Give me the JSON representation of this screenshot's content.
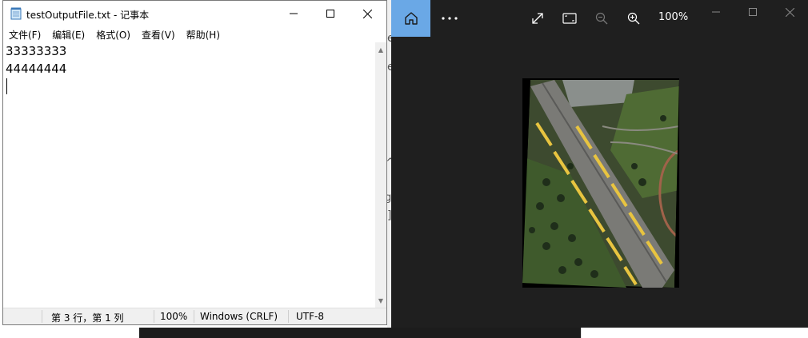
{
  "notepad": {
    "title": "testOutputFile.txt - 记事本",
    "menu": [
      "文件(F)",
      "编辑(E)",
      "格式(O)",
      "查看(V)",
      "帮助(H)"
    ],
    "lines": [
      "33333333",
      "44444444"
    ],
    "status": {
      "position": "第 3 行，第 1 列",
      "zoom": "100%",
      "line_ending": "Windows (CRLF)",
      "encoding": "UTF-8"
    }
  },
  "viewer": {
    "zoom": "100%",
    "icons": [
      "home-icon",
      "more-icon",
      "expand-icon",
      "fit-icon",
      "zoom-out-icon",
      "zoom-in-icon"
    ],
    "accent_color": "#6aa8e6"
  },
  "background": {
    "fragments": [
      "e",
      "e",
      "^",
      "g\\",
      "]"
    ]
  }
}
